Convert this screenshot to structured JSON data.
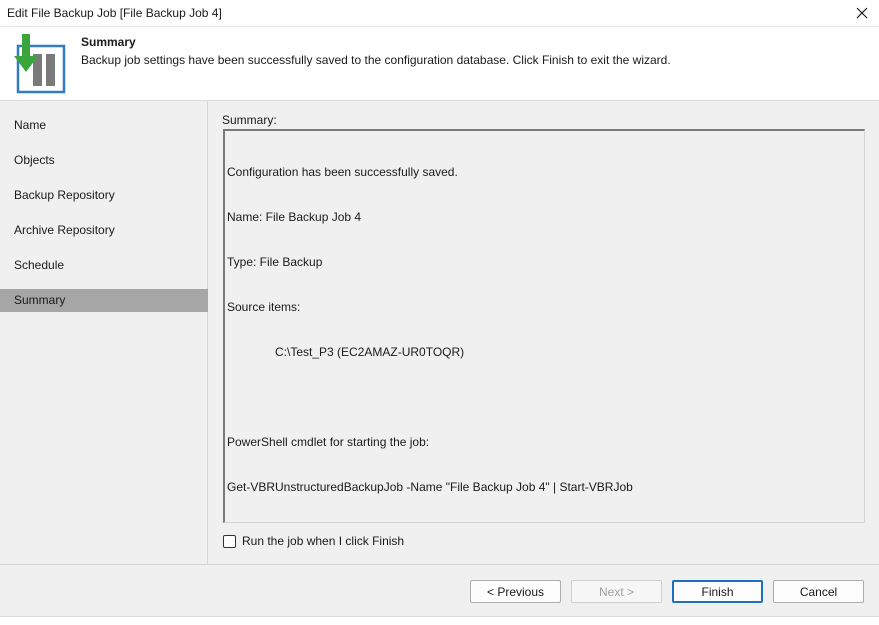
{
  "window": {
    "title": "Edit File Backup Job [File Backup Job 4]",
    "close_glyph": "✕"
  },
  "header": {
    "icon": "backup-job-icon",
    "title": "Summary",
    "description": "Backup job settings have been successfully saved to the configuration database. Click Finish to exit the wizard."
  },
  "sidebar": {
    "items": [
      {
        "label": "Name",
        "active": false
      },
      {
        "label": "Objects",
        "active": false
      },
      {
        "label": "Backup Repository",
        "active": false
      },
      {
        "label": "Archive Repository",
        "active": false
      },
      {
        "label": "Schedule",
        "active": false
      },
      {
        "label": "Summary",
        "active": true
      }
    ]
  },
  "main": {
    "summary_label": "Summary:",
    "summary_lines": {
      "line1": "Configuration has been successfully saved.",
      "line2": "Name: File Backup Job 4",
      "line3": "Type: File Backup",
      "line4": "Source items:",
      "line5": "C:\\Test_P3 (EC2AMAZ-UR0TOQR)",
      "line6": "",
      "line7": "PowerShell cmdlet for starting the job:",
      "line8": "Get-VBRUnstructuredBackupJob -Name \"File Backup Job 4\" | Start-VBRJob"
    },
    "run_checkbox": {
      "label": "Run the job when I click Finish",
      "checked": false
    }
  },
  "footer": {
    "previous": "< Previous",
    "next": "Next >",
    "finish": "Finish",
    "cancel": "Cancel"
  },
  "colors": {
    "accent_green": "#3aa53a",
    "accent_blue": "#2e7dc5",
    "active_nav": "#a6a6a6"
  }
}
